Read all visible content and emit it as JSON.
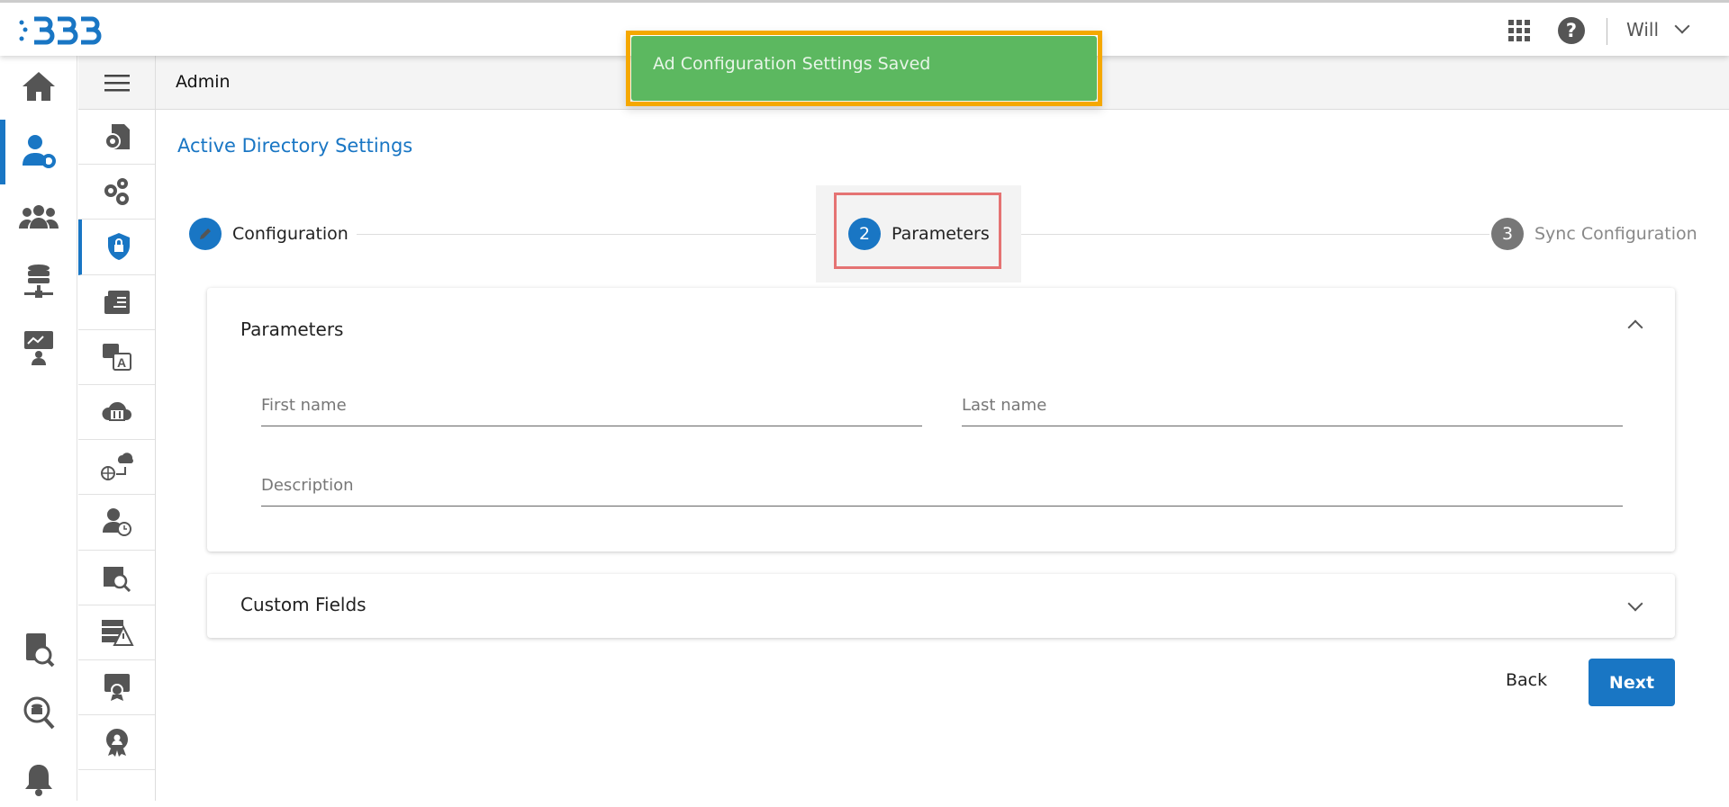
{
  "header": {
    "user_name": "Will",
    "logo_text": "BDB",
    "icons": [
      "apps-grid-icon",
      "help-icon",
      "chevron-down-icon"
    ]
  },
  "toast": {
    "message": "Ad Configuration Settings Saved",
    "color": "#5cb860",
    "highlight": "#f5a800"
  },
  "breadcrumb": {
    "section": "Admin"
  },
  "page": {
    "title": "Active Directory Settings"
  },
  "stepper": {
    "steps": [
      {
        "label": "Configuration",
        "state": "done"
      },
      {
        "number": "2",
        "label": "Parameters",
        "state": "active"
      },
      {
        "number": "3",
        "label": "Sync Configuration",
        "state": "pending"
      }
    ]
  },
  "parameters_card": {
    "title": "Parameters",
    "fields": {
      "first_name": {
        "placeholder": "First name",
        "value": ""
      },
      "last_name": {
        "placeholder": "Last name",
        "value": ""
      },
      "description": {
        "placeholder": "Description",
        "value": ""
      }
    }
  },
  "custom_fields_card": {
    "title": "Custom Fields"
  },
  "actions": {
    "back": "Back",
    "next": "Next"
  },
  "colors": {
    "accent": "#1976c4",
    "icon": "#555555"
  }
}
